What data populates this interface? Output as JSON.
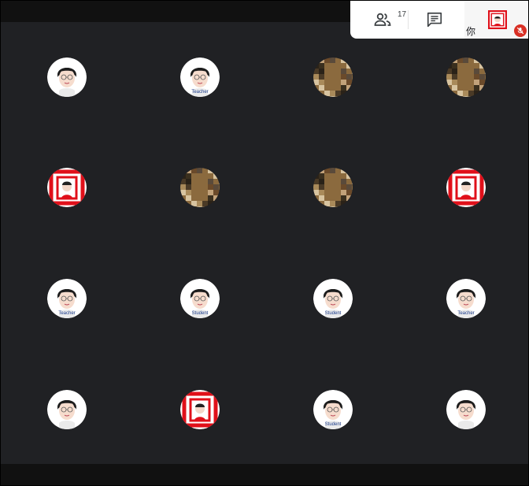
{
  "header": {
    "participants_count": "17",
    "people_icon": "people-icon",
    "chat_icon": "chat-icon",
    "self_label": "你",
    "self_mic": "mic-off-icon"
  },
  "colors": {
    "background": "#202124",
    "bars": "#111111",
    "panel": "#ffffff",
    "mic_off": "#d93025",
    "avatar_red": "#e0101a"
  },
  "tiles": [
    {
      "avatar": "cartoon-face",
      "caption": ""
    },
    {
      "avatar": "cartoon-face",
      "caption": "Teacher"
    },
    {
      "avatar": "pixelated-photo",
      "caption": ""
    },
    {
      "avatar": "pixelated-photo",
      "caption": ""
    },
    {
      "avatar": "red-frame-face",
      "caption": ""
    },
    {
      "avatar": "pixelated-photo",
      "caption": ""
    },
    {
      "avatar": "pixelated-photo",
      "caption": ""
    },
    {
      "avatar": "red-frame-face",
      "caption": ""
    },
    {
      "avatar": "cartoon-face",
      "caption": "Teacher"
    },
    {
      "avatar": "cartoon-face",
      "caption": "Student"
    },
    {
      "avatar": "cartoon-face",
      "caption": "Student"
    },
    {
      "avatar": "cartoon-face",
      "caption": "Teacher"
    },
    {
      "avatar": "cartoon-face",
      "caption": ""
    },
    {
      "avatar": "red-frame-face",
      "caption": ""
    },
    {
      "avatar": "cartoon-face",
      "caption": "Student"
    },
    {
      "avatar": "cartoon-face",
      "caption": ""
    }
  ]
}
